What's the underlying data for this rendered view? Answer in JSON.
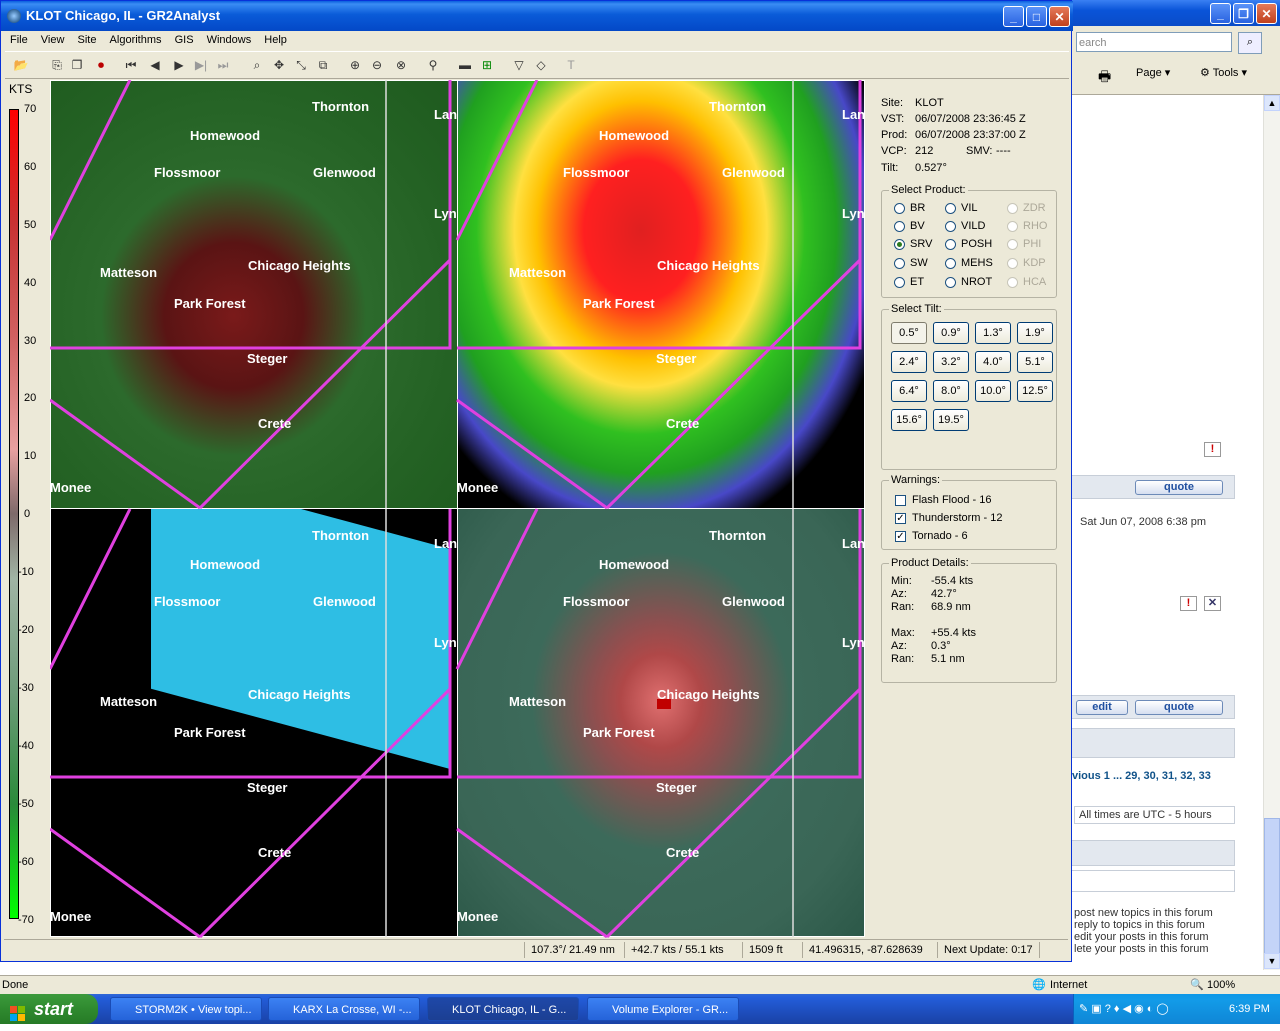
{
  "window": {
    "title": "KLOT Chicago, IL - GR2Analyst"
  },
  "menu": [
    "File",
    "View",
    "Site",
    "Algorithms",
    "GIS",
    "Windows",
    "Help"
  ],
  "colorbar": {
    "unit": "KTS",
    "labels": [
      "70",
      "60",
      "50",
      "40",
      "30",
      "20",
      "10",
      "0",
      "-10",
      "-20",
      "-30",
      "-40",
      "-50",
      "-60",
      "-70"
    ]
  },
  "places": {
    "thornton": "Thornton",
    "homewood": "Homewood",
    "flossmoor": "Flossmoor",
    "glenwood": "Glenwood",
    "matteson": "Matteson",
    "chicago_heights": "Chicago Heights",
    "park_forest": "Park Forest",
    "steger": "Steger",
    "crete": "Crete",
    "monee": "Monee",
    "lyn": "Lyn",
    "lan": "Lan"
  },
  "info": {
    "site_label": "Site:",
    "site": "KLOT",
    "vst_label": "VST:",
    "vst": "06/07/2008  23:36:45 Z",
    "prod_label": "Prod:",
    "prod": "06/07/2008  23:37:00 Z",
    "vcp_label": "VCP:",
    "vcp": "212",
    "smv_label": "SMV:",
    "smv": "----",
    "tilt_label": "Tilt:",
    "tilt": "0.527°"
  },
  "select_product": {
    "title": "Select Product:",
    "col1": [
      "BR",
      "BV",
      "SRV",
      "SW",
      "ET"
    ],
    "col2": [
      "VIL",
      "VILD",
      "POSH",
      "MEHS",
      "NROT"
    ],
    "col3": [
      "ZDR",
      "RHO",
      "PHI",
      "KDP",
      "HCA"
    ],
    "selected": "SRV"
  },
  "select_tilt": {
    "title": "Select Tilt:",
    "tilts": [
      "0.5°",
      "0.9°",
      "1.3°",
      "1.9°",
      "2.4°",
      "3.2°",
      "4.0°",
      "5.1°",
      "6.4°",
      "8.0°",
      "10.0°",
      "12.5°",
      "15.6°",
      "19.5°"
    ],
    "selected": "0.5°"
  },
  "warnings": {
    "title": "Warnings:",
    "items": [
      {
        "label": "Flash Flood - 16",
        "checked": false
      },
      {
        "label": "Thunderstorm - 12",
        "checked": true
      },
      {
        "label": "Tornado - 6",
        "checked": true
      }
    ]
  },
  "product_details": {
    "title": "Product Details:",
    "min_label": "Min:",
    "min": "-55.4 kts",
    "az1_label": "Az:",
    "az1": "42.7°",
    "ran1_label": "Ran:",
    "ran1": "68.9 nm",
    "max_label": "Max:",
    "max": "+55.4 kts",
    "az2_label": "Az:",
    "az2": "0.3°",
    "ran2_label": "Ran:",
    "ran2": "5.1 nm"
  },
  "statusbar": {
    "azran": "107.3°/ 21.49 nm",
    "vel": "+42.7 kts / 55.1 kts",
    "height": "1509 ft",
    "coords": "41.496315, -87.628639",
    "next_update": "Next Update: 0:17"
  },
  "browser": {
    "search_placeholder": "earch",
    "page": "Page",
    "tools": "Tools",
    "quote": "quote",
    "edit": "edit",
    "date": "Sat Jun 07, 2008 6:38 pm",
    "pagination": "vious  1 ... 29, 30, 31, 32, 33",
    "timezone": "All times are UTC - 5 hours",
    "perm1": "post new topics in this forum",
    "perm2": "reply to topics in this forum",
    "perm3": "edit your posts in this forum",
    "perm4": "lete your posts in this forum"
  },
  "ie_status": {
    "done": "Done",
    "zone": "Internet",
    "zoom": "100%"
  },
  "taskbar": {
    "start": "start",
    "tasks": [
      "STORM2K • View topi...",
      "KARX La Crosse, WI -...",
      "KLOT Chicago, IL - G...",
      "Volume Explorer - GR..."
    ],
    "clock": "6:39 PM"
  }
}
